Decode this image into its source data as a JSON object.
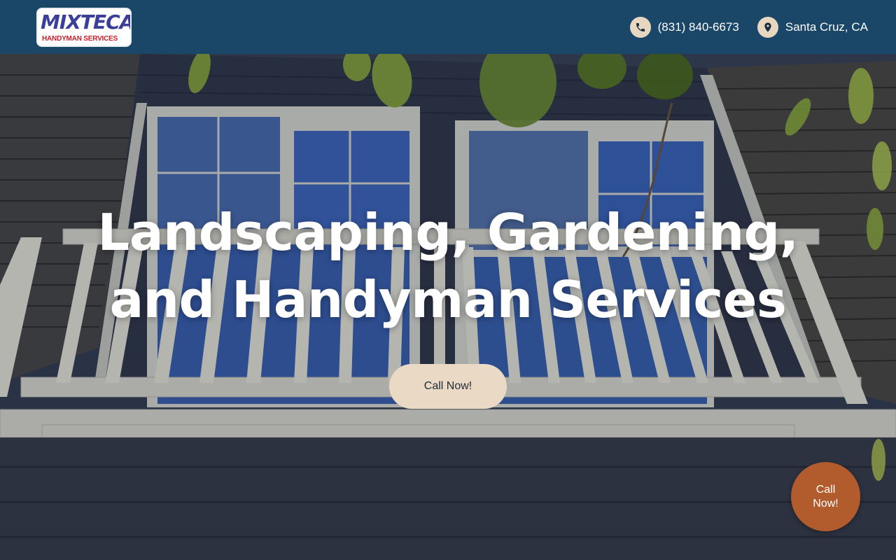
{
  "header": {
    "logo": {
      "word": "MIXTECA",
      "sub": "HANDYMAN SERVICES"
    },
    "phone": {
      "icon": "phone-icon",
      "label": "(831) 840-6673"
    },
    "location": {
      "icon": "map-pin-icon",
      "label": "Santa Cruz, CA"
    }
  },
  "hero": {
    "background": "photo of a dark-sided house with white balcony railing and windows, leaves at top",
    "title_line1": "Landscaping, Gardening,",
    "title_line2": "and Handyman Services",
    "cta_label": "Call Now!"
  },
  "floating_cta": {
    "label": "Call Now!"
  },
  "colors": {
    "header_bg": "#1a4668",
    "button_beige": "#ead9c4",
    "float_button": "#b25c2e",
    "icon_circle": "#e8d7c0"
  }
}
